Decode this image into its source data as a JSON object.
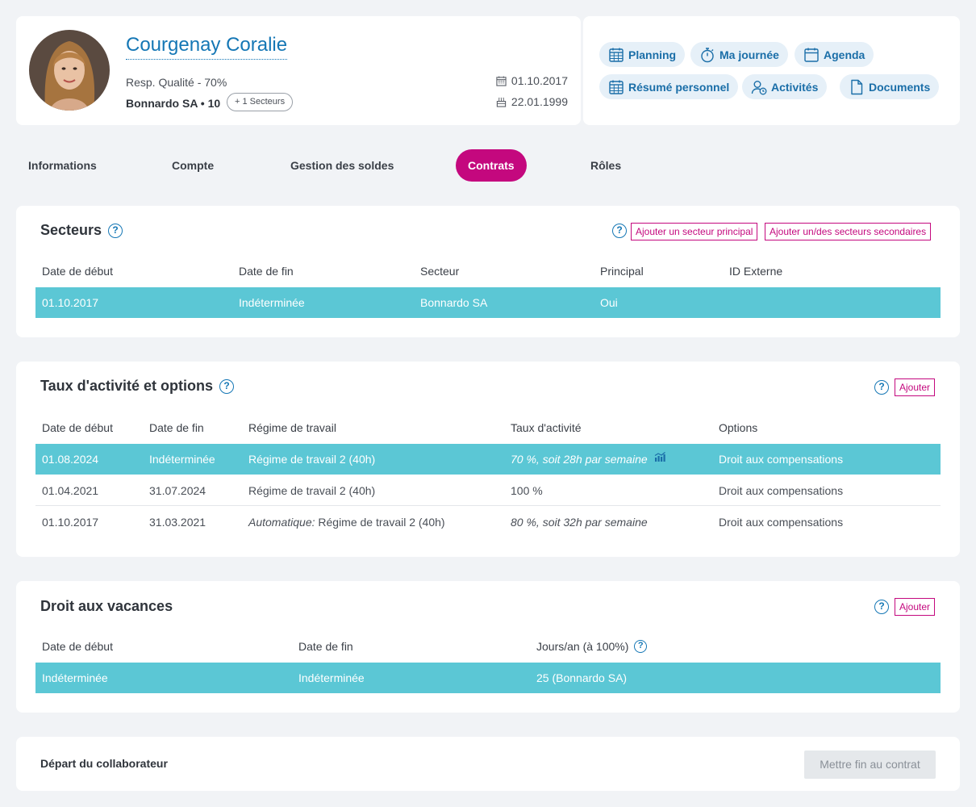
{
  "profile": {
    "name": "Courgenay Coralie",
    "role": "Resp. Qualité - 70%",
    "company": "Bonnardo SA • 10",
    "sectors_pill": "+ 1 Secteurs",
    "entry_date": "01.10.2017",
    "birth_date": "22.01.1999"
  },
  "actions": [
    {
      "label": "Planning",
      "icon": "calendar-grid-icon"
    },
    {
      "label": "Ma journée",
      "icon": "stopwatch-icon"
    },
    {
      "label": "Agenda",
      "icon": "calendar-icon"
    },
    {
      "label": "Résumé personnel",
      "icon": "calendar-grid-icon"
    },
    {
      "label": "Activités",
      "icon": "user-clock-icon"
    },
    {
      "label": "Documents",
      "icon": "document-icon"
    }
  ],
  "tabs": [
    {
      "label": "Informations"
    },
    {
      "label": "Compte"
    },
    {
      "label": "Gestion des soldes"
    },
    {
      "label": "Contrats",
      "active": true
    },
    {
      "label": "Rôles"
    }
  ],
  "secteurs": {
    "title": "Secteurs",
    "btn_primary": "Ajouter un secteur principal",
    "btn_secondary": "Ajouter un/des secteurs secondaires",
    "columns": [
      "Date de début",
      "Date de fin",
      "Secteur",
      "Principal",
      "ID Externe"
    ],
    "rows": [
      [
        "01.10.2017",
        "Indéterminée",
        "Bonnardo SA",
        "Oui",
        ""
      ]
    ]
  },
  "taux": {
    "title": "Taux d'activité et options",
    "btn_add": "Ajouter",
    "columns": [
      "Date de début",
      "Date de fin",
      "Régime de travail",
      "Taux d'activité",
      "Options"
    ],
    "rows": [
      {
        "start": "01.08.2024",
        "end": "Indéterminée",
        "regime_prefix": "",
        "regime": "Régime de travail 2 (40h)",
        "rate": "70 %, soit 28h par semaine",
        "options": "Droit aux compensations"
      },
      {
        "start": "01.04.2021",
        "end": "31.07.2024",
        "regime_prefix": "",
        "regime": "Régime de travail 2 (40h)",
        "rate": "100 %",
        "options": "Droit aux compensations"
      },
      {
        "start": "01.10.2017",
        "end": "31.03.2021",
        "regime_prefix": "Automatique:",
        "regime": " Régime de travail 2 (40h)",
        "rate": "80 %, soit 32h par semaine",
        "options": "Droit aux compensations"
      }
    ]
  },
  "vacances": {
    "title": "Droit aux vacances",
    "btn_add": "Ajouter",
    "columns": [
      "Date de début",
      "Date de fin",
      "Jours/an (à 100%)"
    ],
    "rows": [
      [
        "Indéterminée",
        "Indéterminée",
        "25 (Bonnardo SA)"
      ]
    ]
  },
  "depart": {
    "label": "Départ du collaborateur",
    "button": "Mettre fin au contrat"
  },
  "colors": {
    "accent": "#c4087e",
    "link": "#1577b5",
    "highlight_row": "#5bc7d5"
  }
}
